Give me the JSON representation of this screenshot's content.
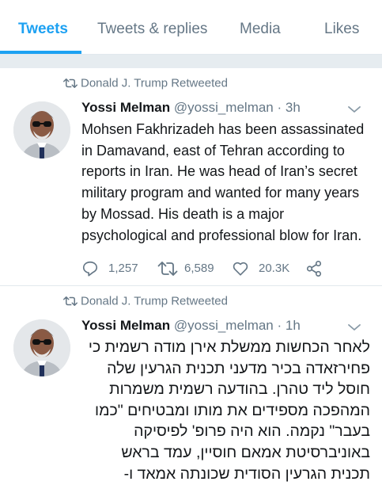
{
  "tabs": [
    {
      "label": "Tweets",
      "active": true
    },
    {
      "label": "Tweets & replies",
      "active": false
    },
    {
      "label": "Media",
      "active": false
    },
    {
      "label": "Likes",
      "active": false
    }
  ],
  "colors": {
    "accent": "#1da1f2",
    "secondary_text": "#657786",
    "text": "#14171a",
    "border": "#e1e8ed",
    "background_gap": "#e6ecf0"
  },
  "tweets": [
    {
      "retweeted_by": "Donald J. Trump Retweeted",
      "author_name": "Yossi Melman",
      "author_handle": "@yossi_melman",
      "time": "· 3h",
      "lines": [
        "Mohsen Fakhrizadeh has been assassinated",
        "in Damavand, east of Tehran according to",
        "reports in Iran. He was head of Iran’s secret",
        "military program and wanted for many years",
        "by Mossad. His death is a major",
        "psychological and professional blow for Iran."
      ],
      "replies": "1,257",
      "retweets": "6,589",
      "likes": "20.3K"
    },
    {
      "retweeted_by": "Donald J. Trump Retweeted",
      "author_name": "Yossi Melman",
      "author_handle": "@yossi_melman",
      "time": "· 1h",
      "lines": [
        "לאחר הכחשות ממשלת אירן מודה רשמית כי",
        "פחירזאדה בכיר מדעני תכנית הגרעין שלה",
        "חוסל ליד טהרן. בהודעה רשמית משמרות",
        "המהפכה מספידים את מותו ומבטיחים \"כמו",
        "בעבר\" נקמה. הוא היה פרופ' לפיסיקה",
        "באוניברסיטת אמאם חוסיין, עמד בראש",
        "תכנית הגרעין הסודית שכונתה אמאד ו-"
      ]
    }
  ],
  "icons": {
    "retweet": "retweet-icon",
    "reply": "reply-icon",
    "like": "heart-icon",
    "share": "share-icon",
    "caret": "chevron-down-icon"
  }
}
